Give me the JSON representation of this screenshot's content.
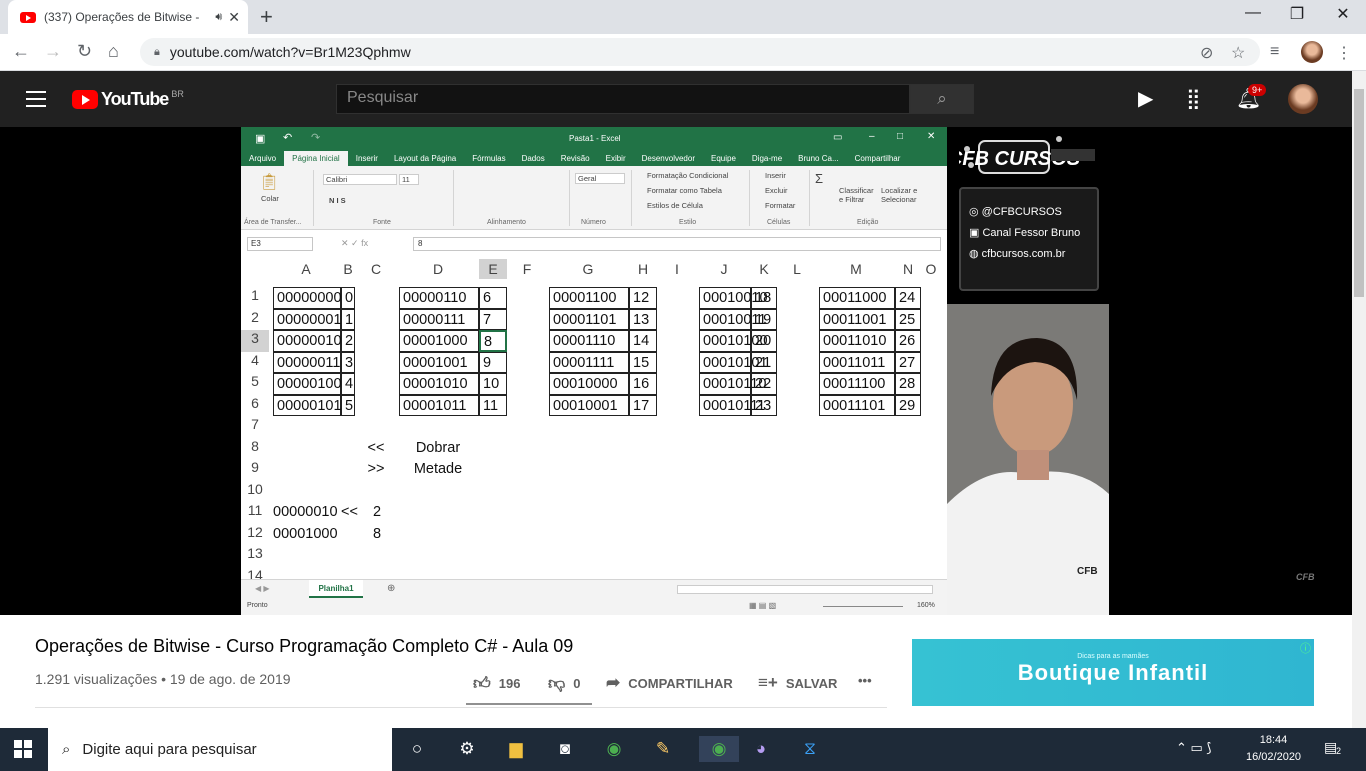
{
  "browser": {
    "tab_title": "(337) Operações de Bitwise -",
    "tab_audio_icon": "speaker-icon",
    "url": "youtube.com/watch?v=Br1M23Qphmw"
  },
  "youtube": {
    "logo_text": "YouTube",
    "region": "BR",
    "search_placeholder": "Pesquisar",
    "notif_count": "9+"
  },
  "excel": {
    "window_title": "Pasta1 - Excel",
    "user": "Bruno Ca...",
    "tabs": [
      "Arquivo",
      "Página Inicial",
      "Inserir",
      "Layout da Página",
      "Fórmulas",
      "Dados",
      "Revisão",
      "Exibir",
      "Desenvolvedor",
      "Equipe"
    ],
    "tell_me": "Diga-me",
    "share": "Compartilhar",
    "ribbon": {
      "paste": "Colar",
      "font": "Calibri",
      "size": "11",
      "number_format": "Geral",
      "cond_format": "Formatação Condicional",
      "format_table": "Formatar como Tabela",
      "cell_styles": "Estilos de Célula",
      "insert": "Inserir",
      "delete": "Excluir",
      "format": "Formatar",
      "sort": "Classificar e Filtrar",
      "find": "Localizar e Selecionar",
      "groups": [
        "Área de Transfer...",
        "Fonte",
        "Alinhamento",
        "Número",
        "Estilo",
        "Células",
        "Edição"
      ]
    },
    "name_box": "E3",
    "formula": "8",
    "columns": [
      "A",
      "B",
      "C",
      "D",
      "E",
      "F",
      "G",
      "H",
      "I",
      "J",
      "K",
      "L",
      "M",
      "N",
      "O"
    ],
    "rows": [
      "1",
      "2",
      "3",
      "4",
      "5",
      "6",
      "7",
      "8",
      "9",
      "10",
      "11",
      "12",
      "13",
      "14"
    ],
    "tables": [
      {
        "bin": [
          "00000000",
          "00000001",
          "00000010",
          "00000011",
          "00000100",
          "00000101"
        ],
        "dec": [
          "0",
          "1",
          "2",
          "3",
          "4",
          "5"
        ]
      },
      {
        "bin": [
          "00000110",
          "00000111",
          "00001000",
          "00001001",
          "00001010",
          "00001011"
        ],
        "dec": [
          "6",
          "7",
          "8",
          "9",
          "10",
          "11"
        ]
      },
      {
        "bin": [
          "00001100",
          "00001101",
          "00001110",
          "00001111",
          "00010000",
          "00010001"
        ],
        "dec": [
          "12",
          "13",
          "14",
          "15",
          "16",
          "17"
        ]
      },
      {
        "bin": [
          "00010010",
          "00010011",
          "00010100",
          "00010101",
          "00010110",
          "00010111"
        ],
        "dec": [
          "18",
          "19",
          "20",
          "21",
          "22",
          "23"
        ]
      },
      {
        "bin": [
          "00011000",
          "00011001",
          "00011010",
          "00011011",
          "00011100",
          "00011101"
        ],
        "dec": [
          "24",
          "25",
          "26",
          "27",
          "28",
          "29"
        ]
      }
    ],
    "notes": {
      "shl": "<<",
      "shl_label": "Dobrar",
      "shr": ">>",
      "shr_label": "Metade",
      "r11_a": "00000010",
      "r11_op": "<<",
      "r11_n": "2",
      "r12_a": "00001000",
      "r12_n": "8"
    },
    "sheet_tab": "Planilha1",
    "status": "Pronto",
    "zoom": "160%"
  },
  "channel": {
    "name": "CFB CURSOS",
    "instagram": "@CFBCURSOS",
    "facebook": "Canal Fessor Bruno",
    "website": "cfbcursos.com.br"
  },
  "video": {
    "title": "Operações de Bitwise - Curso Programação Completo C# - Aula 09",
    "views": "1.291 visualizações",
    "date": "19 de ago. de 2019",
    "likes": "196",
    "dislikes": "0",
    "share": "COMPARTILHAR",
    "save": "SALVAR",
    "more": "•••"
  },
  "ad": {
    "subtitle": "Dicas para as mamães",
    "brand": "Boutique Infantil"
  },
  "taskbar": {
    "search_placeholder": "Digite aqui para pesquisar",
    "time": "18:44",
    "date": "16/02/2020",
    "notifications": "2"
  }
}
